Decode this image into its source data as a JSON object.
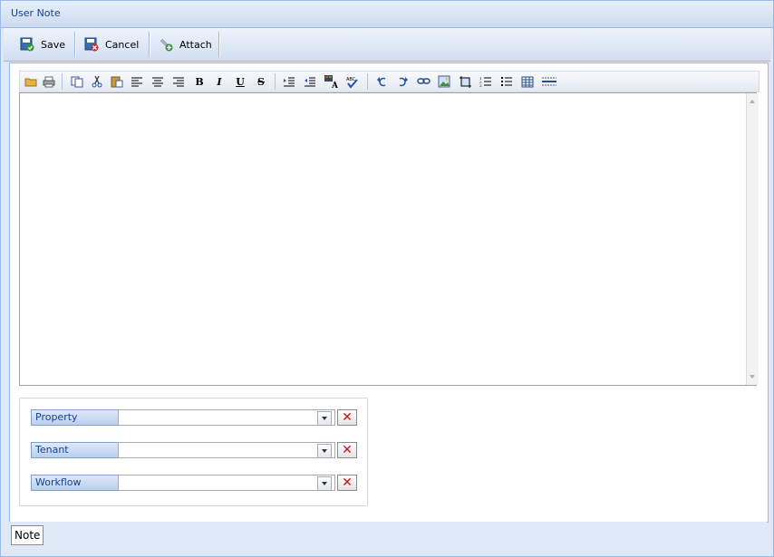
{
  "window": {
    "title": "User Note"
  },
  "toolbar": {
    "save_label": "Save",
    "cancel_label": "Cancel",
    "attach_label": "Attach"
  },
  "editor": {
    "buttons": [
      "folder-open",
      "print",
      "copy",
      "cut",
      "paste",
      "align-left",
      "align-center",
      "align-right",
      "bold",
      "italic",
      "underline",
      "strikethrough",
      "indent",
      "outdent",
      "font-color",
      "spellcheck",
      "undo",
      "redo",
      "link",
      "image",
      "crop",
      "ordered-list",
      "unordered-list",
      "table",
      "horizontal-rule"
    ],
    "bold_glyph": "B",
    "italic_glyph": "I",
    "underline_glyph": "U",
    "strike_glyph": "S",
    "content": ""
  },
  "fields": {
    "property": {
      "label": "Property",
      "value": ""
    },
    "tenant": {
      "label": "Tenant",
      "value": ""
    },
    "workflow": {
      "label": "Workflow",
      "value": ""
    },
    "clear_glyph": "✕"
  },
  "tabs": {
    "note": "Note"
  },
  "colors": {
    "accent": "#15428b",
    "border": "#99bbe8",
    "background": "#dfe8f6"
  }
}
